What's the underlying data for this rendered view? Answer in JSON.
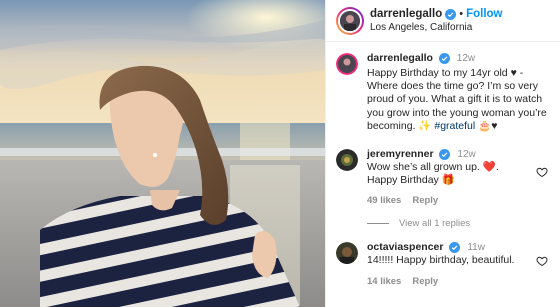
{
  "post": {
    "username": "darrenlegallo",
    "follow_label": "Follow",
    "separator": "•",
    "location": "Los Angeles, California"
  },
  "comments": [
    {
      "username": "darrenlegallo",
      "time": "12w",
      "text": "Happy Birthday to my 14yr old ♥ - Where does the time go? I’m so very proud of you. What a gift it is to watch you grow into the young woman you’re becoming. ✨ ",
      "hashtag": "#grateful",
      "emoji_tail": " 🎂♥"
    },
    {
      "username": "jeremyrenner",
      "time": "12w",
      "text": "Wow she’s all grown up. ❤️. Happy Birthday 🎁",
      "likes": "49 likes",
      "reply_label": "Reply"
    },
    {
      "username": "octaviaspencer",
      "time": "11w",
      "text": "14!!!!! Happy birthday, beautiful.",
      "likes": "14 likes",
      "reply_label": "Reply"
    }
  ],
  "view_replies": "View all 1 replies",
  "colors": {
    "accent": "#0095f6",
    "verified": "#3897f0",
    "muted": "#8e8e8e",
    "text": "#262626",
    "hashtag": "#00376b"
  },
  "icons": [
    "verified-badge-icon",
    "heart-icon"
  ]
}
